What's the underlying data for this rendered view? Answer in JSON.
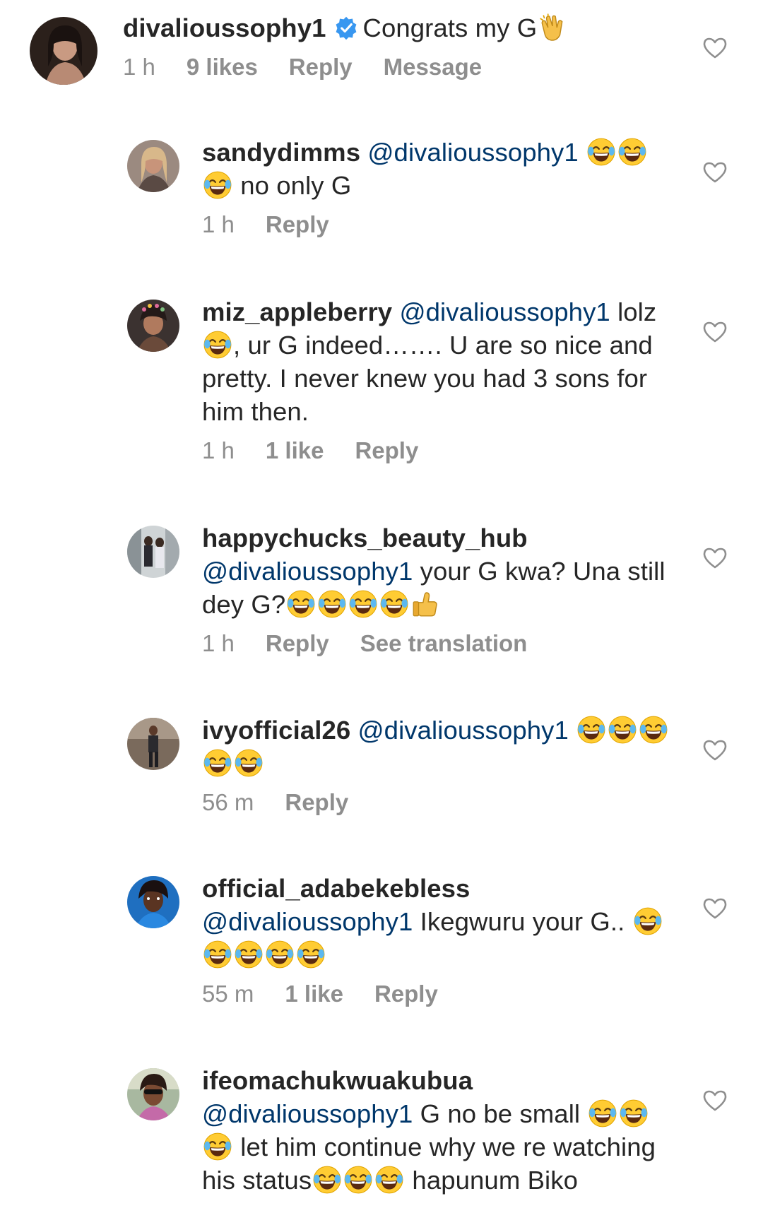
{
  "comments": [
    {
      "username": "divalioussophy1",
      "verified": true,
      "segments": [
        {
          "t": "text",
          "v": "Congrats my G"
        },
        {
          "t": "emoji",
          "e": "clap"
        }
      ],
      "meta": {
        "time": "1 h",
        "likes": "9 likes",
        "reply": "Reply",
        "extra": "Message"
      }
    },
    {
      "username": "sandydimms",
      "segments": [
        {
          "t": "mention",
          "v": "@divalioussophy1"
        },
        {
          "t": "emoji",
          "e": "joy"
        },
        {
          "t": "emoji",
          "e": "joy"
        },
        {
          "t": "emoji",
          "e": "joy"
        },
        {
          "t": "text",
          "v": " no only G"
        }
      ],
      "meta": {
        "time": "1 h",
        "likes": "",
        "reply": "Reply",
        "extra": ""
      }
    },
    {
      "username": "miz_appleberry",
      "segments": [
        {
          "t": "mention",
          "v": "@divalioussophy1"
        },
        {
          "t": "text",
          "v": " lolz "
        },
        {
          "t": "emoji",
          "e": "joy"
        },
        {
          "t": "text",
          "v": ", ur G indeed……. U are so nice and pretty. I never knew you had 3 sons for him then."
        }
      ],
      "meta": {
        "time": "1 h",
        "likes": "1 like",
        "reply": "Reply",
        "extra": ""
      }
    },
    {
      "username": "happychucks_beauty_hub",
      "segments": [
        {
          "t": "mention",
          "v": "@divalioussophy1"
        },
        {
          "t": "text",
          "v": " your G kwa? Una still dey G?"
        },
        {
          "t": "emoji",
          "e": "joy"
        },
        {
          "t": "emoji",
          "e": "joy"
        },
        {
          "t": "emoji",
          "e": "joy"
        },
        {
          "t": "emoji",
          "e": "joy"
        },
        {
          "t": "emoji",
          "e": "thumbs"
        }
      ],
      "meta": {
        "time": "1 h",
        "likes": "",
        "reply": "Reply",
        "extra": "See translation"
      }
    },
    {
      "username": "ivyofficial26",
      "segments": [
        {
          "t": "mention",
          "v": "@divalioussophy1"
        },
        {
          "t": "text",
          "v": " "
        },
        {
          "t": "emoji",
          "e": "joy"
        },
        {
          "t": "emoji",
          "e": "joy"
        },
        {
          "t": "emoji",
          "e": "joy"
        },
        {
          "t": "emoji",
          "e": "joy"
        },
        {
          "t": "emoji",
          "e": "joy"
        }
      ],
      "meta": {
        "time": "56 m",
        "likes": "",
        "reply": "Reply",
        "extra": ""
      }
    },
    {
      "username": "official_adabekebless",
      "segments": [
        {
          "t": "mention",
          "v": "@divalioussophy1"
        },
        {
          "t": "text",
          "v": " Ikegwuru your G.. "
        },
        {
          "t": "emoji",
          "e": "joy"
        },
        {
          "t": "emoji",
          "e": "joy"
        },
        {
          "t": "emoji",
          "e": "joy"
        },
        {
          "t": "emoji",
          "e": "joy"
        },
        {
          "t": "emoji",
          "e": "joy"
        }
      ],
      "meta": {
        "time": "55 m",
        "likes": "1 like",
        "reply": "Reply",
        "extra": ""
      }
    },
    {
      "username": "ifeomachukwuakubua",
      "segments": [
        {
          "t": "mention",
          "v": "@divalioussophy1"
        },
        {
          "t": "text",
          "v": " G no be small "
        },
        {
          "t": "emoji",
          "e": "joy"
        },
        {
          "t": "emoji",
          "e": "joy"
        },
        {
          "t": "emoji",
          "e": "joy"
        },
        {
          "t": "text",
          "v": " let him continue why we re watching his status"
        },
        {
          "t": "emoji",
          "e": "joy"
        },
        {
          "t": "emoji",
          "e": "joy"
        },
        {
          "t": "emoji",
          "e": "joy"
        },
        {
          "t": "text",
          "v": " hapunum Biko"
        }
      ],
      "meta": {
        "time": "",
        "likes": "",
        "reply": "",
        "extra": ""
      }
    }
  ],
  "icons": {
    "like": "heart-outline-icon",
    "verified": "verified-badge-icon",
    "joy_emoji": "face-with-tears-of-joy-emoji",
    "clap_emoji": "clapping-hands-emoji",
    "thumbs_emoji": "thumbs-up-emoji"
  },
  "colors": {
    "username": "#262626",
    "mention": "#00376b",
    "meta": "#8e8e8e",
    "verified": "#3897f0"
  }
}
